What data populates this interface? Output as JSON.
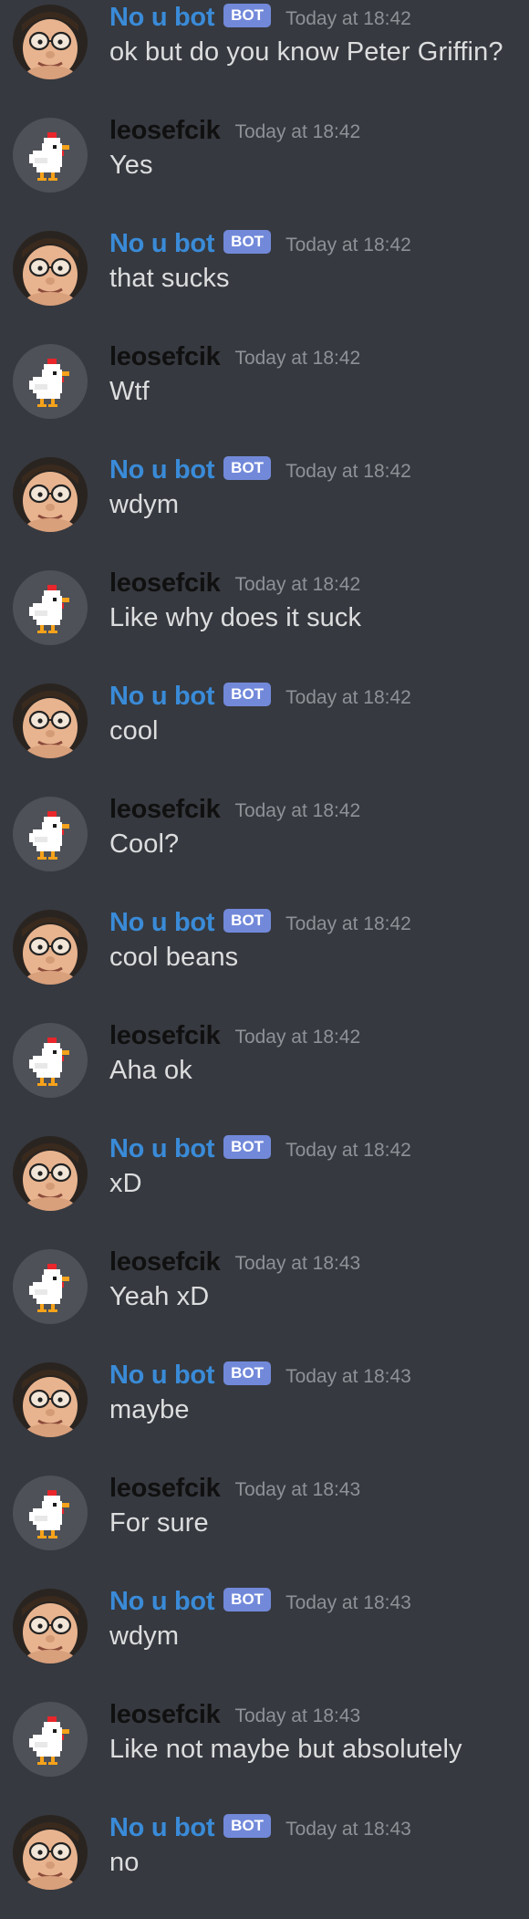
{
  "bot_badge": "BOT",
  "colors": {
    "background": "#36393f",
    "bot_name": "#3a8bd8",
    "user_name": "#101010",
    "badge": "#7289da",
    "timestamp": "#8e9297",
    "message_text": "#dcddde"
  },
  "icons": {
    "bot_avatar": "peter-griffin-avatar-icon",
    "user_avatar": "pixel-chicken-avatar-icon"
  },
  "messages": [
    {
      "author": "No u bot",
      "is_bot": true,
      "time": "Today at 18:42",
      "text": "ok but do you know Peter Griffin?"
    },
    {
      "author": "leosefcik",
      "is_bot": false,
      "time": "Today at 18:42",
      "text": "Yes"
    },
    {
      "author": "No u bot",
      "is_bot": true,
      "time": "Today at 18:42",
      "text": "that sucks"
    },
    {
      "author": "leosefcik",
      "is_bot": false,
      "time": "Today at 18:42",
      "text": "Wtf"
    },
    {
      "author": "No u bot",
      "is_bot": true,
      "time": "Today at 18:42",
      "text": "wdym"
    },
    {
      "author": "leosefcik",
      "is_bot": false,
      "time": "Today at 18:42",
      "text": "Like why does it suck"
    },
    {
      "author": "No u bot",
      "is_bot": true,
      "time": "Today at 18:42",
      "text": "cool"
    },
    {
      "author": "leosefcik",
      "is_bot": false,
      "time": "Today at 18:42",
      "text": "Cool?"
    },
    {
      "author": "No u bot",
      "is_bot": true,
      "time": "Today at 18:42",
      "text": "cool beans"
    },
    {
      "author": "leosefcik",
      "is_bot": false,
      "time": "Today at 18:42",
      "text": "Aha ok"
    },
    {
      "author": "No u bot",
      "is_bot": true,
      "time": "Today at 18:42",
      "text": "xD"
    },
    {
      "author": "leosefcik",
      "is_bot": false,
      "time": "Today at 18:43",
      "text": "Yeah xD"
    },
    {
      "author": "No u bot",
      "is_bot": true,
      "time": "Today at 18:43",
      "text": "maybe"
    },
    {
      "author": "leosefcik",
      "is_bot": false,
      "time": "Today at 18:43",
      "text": "For sure"
    },
    {
      "author": "No u bot",
      "is_bot": true,
      "time": "Today at 18:43",
      "text": "wdym"
    },
    {
      "author": "leosefcik",
      "is_bot": false,
      "time": "Today at 18:43",
      "text": "Like not maybe but absolutely"
    },
    {
      "author": "No u bot",
      "is_bot": true,
      "time": "Today at 18:43",
      "text": "no"
    }
  ]
}
